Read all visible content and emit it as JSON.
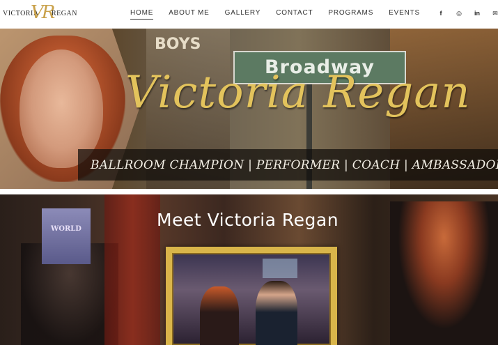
{
  "logo": {
    "name_left": "VICTORIA",
    "monogram": "VR",
    "name_right": "REGAN"
  },
  "nav": {
    "items": [
      {
        "label": "HOME"
      },
      {
        "label": "ABOUT ME"
      },
      {
        "label": "GALLERY"
      },
      {
        "label": "CONTACT"
      },
      {
        "label": "PROGRAMS"
      },
      {
        "label": "EVENTS"
      }
    ],
    "active": "HOME"
  },
  "social": {
    "icons": [
      {
        "name": "facebook-icon",
        "glyph": "f"
      },
      {
        "name": "instagram-icon",
        "glyph": "◎"
      },
      {
        "name": "linkedin-icon",
        "glyph": "in"
      },
      {
        "name": "email-icon",
        "glyph": "✉"
      }
    ]
  },
  "hero": {
    "title": "Victoria Regan",
    "tagline": "BALLROOM CHAMPION | PERFORMER | COACH | AMBASSADOR",
    "sign_text": "Broadway",
    "marquee_text": "BOYS"
  },
  "meet": {
    "heading": "Meet Victoria Regan",
    "poster_text": "WORLD"
  },
  "colors": {
    "accent_gold": "#e3c35c",
    "frame_gold": "#d9b54a",
    "nav_text": "#333333"
  }
}
